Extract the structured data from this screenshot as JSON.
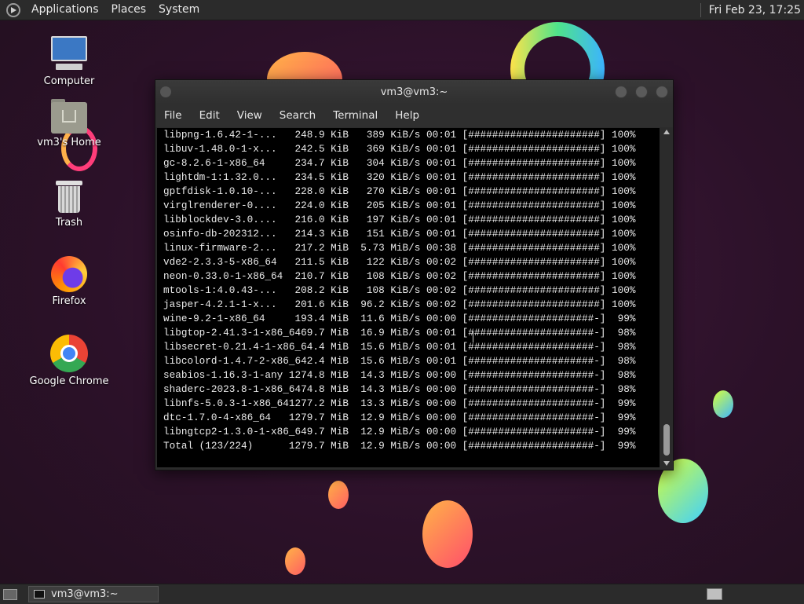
{
  "top_panel": {
    "menus": [
      "Applications",
      "Places",
      "System"
    ],
    "clock": "Fri Feb 23, 17:25"
  },
  "desktop_icons": [
    {
      "label": "Computer",
      "icon": "computer-icon"
    },
    {
      "label": "vm3's Home",
      "icon": "home-folder-icon"
    },
    {
      "label": "Trash",
      "icon": "trash-icon"
    },
    {
      "label": "Firefox",
      "icon": "firefox-icon"
    },
    {
      "label": "Google Chrome",
      "icon": "chrome-icon"
    }
  ],
  "terminal": {
    "title": "vm3@vm3:~",
    "menus": [
      "File",
      "Edit",
      "View",
      "Search",
      "Terminal",
      "Help"
    ],
    "lines": [
      "libpng-1.6.42-1-...   248.9 KiB   389 KiB/s 00:01 [######################] 100%",
      "libuv-1.48.0-1-x...   242.5 KiB   369 KiB/s 00:01 [######################] 100%",
      "gc-8.2.6-1-x86_64     234.7 KiB   304 KiB/s 00:01 [######################] 100%",
      "lightdm-1:1.32.0...   234.5 KiB   320 KiB/s 00:01 [######################] 100%",
      "gptfdisk-1.0.10-...   228.0 KiB   270 KiB/s 00:01 [######################] 100%",
      "virglrenderer-0....   224.0 KiB   205 KiB/s 00:01 [######################] 100%",
      "libblockdev-3.0....   216.0 KiB   197 KiB/s 00:01 [######################] 100%",
      "osinfo-db-202312...   214.3 KiB   151 KiB/s 00:01 [######################] 100%",
      "linux-firmware-2...   217.2 MiB  5.73 MiB/s 00:38 [######################] 100%",
      "vde2-2.3.3-5-x86_64   211.5 KiB   122 KiB/s 00:02 [######################] 100%",
      "neon-0.33.0-1-x86_64  210.7 KiB   108 KiB/s 00:02 [######################] 100%",
      "mtools-1:4.0.43-...   208.2 KiB   108 KiB/s 00:02 [######################] 100%",
      "jasper-4.2.1-1-x...   201.6 KiB  96.2 KiB/s 00:02 [######################] 100%",
      "wine-9.2-1-x86_64     193.4 MiB  11.6 MiB/s 00:00 [#####################-]  99%",
      "libgtop-2.41.3-1-x86_6469.7 MiB  16.9 MiB/s 00:01 [#####################-]  98%",
      "libsecret-0.21.4-1-x86_64.4 MiB  15.6 MiB/s 00:01 [#####################-]  98%",
      "libcolord-1.4.7-2-x86_642.4 MiB  15.6 MiB/s 00:01 [#####################-]  98%",
      "seabios-1.16.3-1-any 1274.8 MiB  14.3 MiB/s 00:00 [#####################-]  98%",
      "shaderc-2023.8-1-x86_6474.8 MiB  14.3 MiB/s 00:00 [#####################-]  98%",
      "libnfs-5.0.3-1-x86_641277.2 MiB  13.3 MiB/s 00:00 [#####################-]  99%",
      "dtc-1.7.0-4-x86_64   1279.7 MiB  12.9 MiB/s 00:00 [#####################-]  99%",
      "libngtcp2-1.3.0-1-x86_649.7 MiB  12.9 MiB/s 00:00 [#####################-]  99%",
      "Total (123/224)      1279.7 MiB  12.9 MiB/s 00:00 [#####################-]  99%"
    ]
  },
  "taskbar": {
    "task_label": "vm3@vm3:~"
  }
}
